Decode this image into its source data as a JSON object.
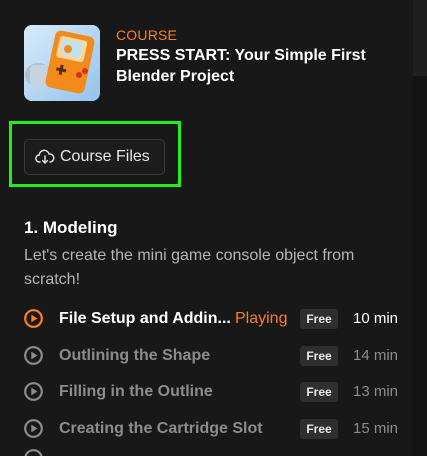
{
  "course": {
    "kicker": "COURSE",
    "title": "PRESS START: Your Simple First Blender Project",
    "thumbnail_icon": "game-console-thumbnail"
  },
  "files_button": {
    "label": "Course Files",
    "icon": "cloud-download-icon"
  },
  "section": {
    "title": "1. Modeling",
    "description": "Let's create the mini game console object from scratch!"
  },
  "lessons": [
    {
      "name": "File Setup and Addin...",
      "status": "Playing",
      "badge": "Free",
      "duration": "10 min",
      "icon": "play-circle-icon"
    },
    {
      "name": "Outlining the Shape",
      "status": "",
      "badge": "Free",
      "duration": "14 min",
      "icon": "play-circle-icon"
    },
    {
      "name": "Filling in the Outline",
      "status": "",
      "badge": "Free",
      "duration": "13 min",
      "icon": "play-circle-icon"
    },
    {
      "name": "Creating the Cartridge Slot",
      "status": "",
      "badge": "Free",
      "duration": "15 min",
      "icon": "play-circle-icon"
    }
  ],
  "colors": {
    "accent": "#ff7f1a",
    "highlight": "#22ee1f",
    "background": "#181818"
  }
}
